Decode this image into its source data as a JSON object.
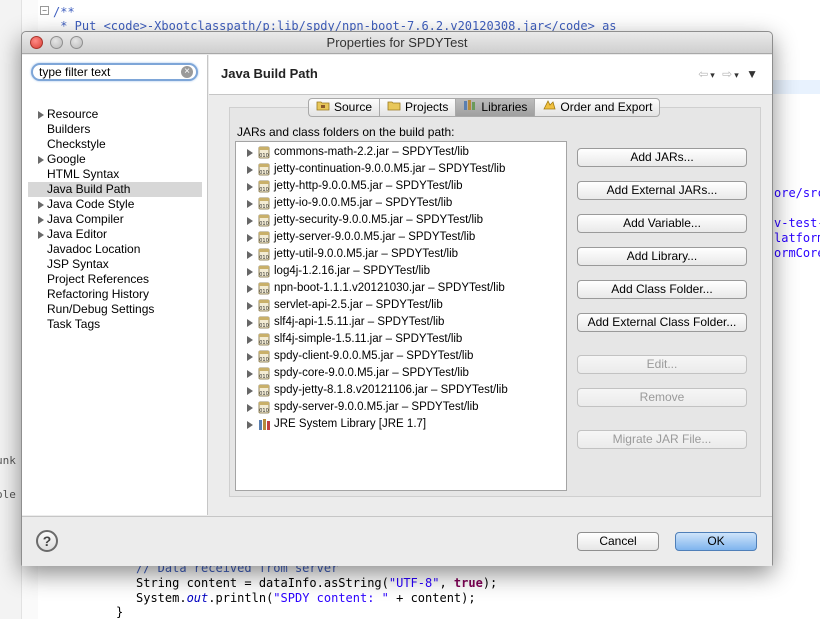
{
  "editor": {
    "top_lines": [
      "/**",
      " * Put <code>-Xbootclasspath/p:lib/spdy/npn-boot-7.6.2.v20120308.jar</code> as"
    ],
    "right_fragments": [
      "ore/src/",
      "v-test-",
      "latform",
      "ormCore"
    ],
    "left_fragments": [
      "unk",
      "ole"
    ],
    "bottom_comment": "// Data received from server",
    "bottom_line1_prefix": "String content = dataInfo.asString(",
    "bottom_line1_str": "\"UTF-8\"",
    "bottom_line1_mid": ", ",
    "bottom_line1_kw": "true",
    "bottom_line1_end": ");",
    "bottom_line2_prefix": "System.",
    "bottom_line2_out": "out",
    "bottom_line2_mid": ".println(",
    "bottom_line2_str": "\"SPDY content: \"",
    "bottom_line2_end": " + content);",
    "bottom_line3": "}"
  },
  "dialog": {
    "title": "Properties for SPDYTest",
    "filter_placeholder": "type filter text",
    "filter_value": "type filter text",
    "nav_items": [
      {
        "label": "Resource",
        "expandable": true
      },
      {
        "label": "Builders",
        "expandable": false
      },
      {
        "label": "Checkstyle",
        "expandable": false
      },
      {
        "label": "Google",
        "expandable": true
      },
      {
        "label": "HTML Syntax",
        "expandable": false
      },
      {
        "label": "Java Build Path",
        "expandable": false,
        "selected": true
      },
      {
        "label": "Java Code Style",
        "expandable": true
      },
      {
        "label": "Java Compiler",
        "expandable": true
      },
      {
        "label": "Java Editor",
        "expandable": true
      },
      {
        "label": "Javadoc Location",
        "expandable": false
      },
      {
        "label": "JSP Syntax",
        "expandable": false
      },
      {
        "label": "Project References",
        "expandable": false
      },
      {
        "label": "Refactoring History",
        "expandable": false
      },
      {
        "label": "Run/Debug Settings",
        "expandable": false
      },
      {
        "label": "Task Tags",
        "expandable": false
      }
    ],
    "pane_title": "Java Build Path",
    "tabs": [
      {
        "label": "Source",
        "icon": "source-folder-icon",
        "active": false
      },
      {
        "label": "Projects",
        "icon": "projects-folder-icon",
        "active": false
      },
      {
        "label": "Libraries",
        "icon": "libraries-icon",
        "active": true
      },
      {
        "label": "Order and Export",
        "icon": "order-export-icon",
        "active": false
      }
    ],
    "jars_label": "JARs and class folders on the build path:",
    "jars": [
      "commons-math-2.2.jar – SPDYTest/lib",
      "jetty-continuation-9.0.0.M5.jar – SPDYTest/lib",
      "jetty-http-9.0.0.M5.jar – SPDYTest/lib",
      "jetty-io-9.0.0.M5.jar – SPDYTest/lib",
      "jetty-security-9.0.0.M5.jar – SPDYTest/lib",
      "jetty-server-9.0.0.M5.jar – SPDYTest/lib",
      "jetty-util-9.0.0.M5.jar – SPDYTest/lib",
      "log4j-1.2.16.jar – SPDYTest/lib",
      "npn-boot-1.1.1.v20121030.jar – SPDYTest/lib",
      "servlet-api-2.5.jar – SPDYTest/lib",
      "slf4j-api-1.5.11.jar – SPDYTest/lib",
      "slf4j-simple-1.5.11.jar – SPDYTest/lib",
      "spdy-client-9.0.0.M5.jar – SPDYTest/lib",
      "spdy-core-9.0.0.M5.jar – SPDYTest/lib",
      "spdy-jetty-8.1.8.v20121106.jar – SPDYTest/lib",
      "spdy-server-9.0.0.M5.jar – SPDYTest/lib",
      "JRE System Library [JRE 1.7]"
    ],
    "buttons": {
      "add_jars": "Add JARs...",
      "add_external_jars": "Add External JARs...",
      "add_variable": "Add Variable...",
      "add_library": "Add Library...",
      "add_class_folder": "Add Class Folder...",
      "add_external_class_folder": "Add External Class Folder...",
      "edit": "Edit...",
      "remove": "Remove",
      "migrate_jar": "Migrate JAR File..."
    },
    "help_label": "?",
    "cancel_label": "Cancel",
    "ok_label": "OK"
  },
  "colors": {
    "accent": "#7fb4ee",
    "selection": "#d7d7d7",
    "comment": "#3f5fbf",
    "keyword": "#7f0055",
    "string": "#2a00ff"
  }
}
